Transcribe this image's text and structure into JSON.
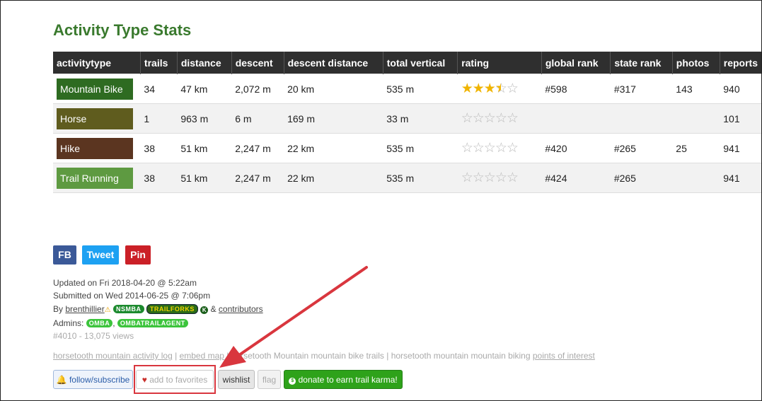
{
  "page_title": "Activity Type Stats",
  "table": {
    "headers": [
      "activitytype",
      "trails",
      "distance",
      "descent",
      "descent distance",
      "total vertical",
      "rating",
      "global rank",
      "state rank",
      "photos",
      "reports"
    ],
    "rows": [
      {
        "activity": "Mountain Bike",
        "color": "#2e6b21",
        "trails": "34",
        "distance": "47 km",
        "descent": "2,072 m",
        "descent_distance": "20 km",
        "total_vertical": "535 m",
        "rating": 3.5,
        "global_rank": "#598",
        "state_rank": "#317",
        "photos": "143",
        "reports": "940"
      },
      {
        "activity": "Horse",
        "color": "#5f5c1e",
        "trails": "1",
        "distance": "963 m",
        "descent": "6 m",
        "descent_distance": "169 m",
        "total_vertical": "33 m",
        "rating": 0,
        "global_rank": "",
        "state_rank": "",
        "photos": "",
        "reports": "101"
      },
      {
        "activity": "Hike",
        "color": "#5b3520",
        "trails": "38",
        "distance": "51 km",
        "descent": "2,247 m",
        "descent_distance": "22 km",
        "total_vertical": "535 m",
        "rating": 0,
        "global_rank": "#420",
        "state_rank": "#265",
        "photos": "25",
        "reports": "941"
      },
      {
        "activity": "Trail Running",
        "color": "#5e9a41",
        "trails": "38",
        "distance": "51 km",
        "descent": "2,247 m",
        "descent_distance": "22 km",
        "total_vertical": "535 m",
        "rating": 0,
        "global_rank": "#424",
        "state_rank": "#265",
        "photos": "",
        "reports": "941"
      }
    ]
  },
  "share": {
    "fb": {
      "label": "FB",
      "color": "#3b5998"
    },
    "tweet": {
      "label": "Tweet",
      "color": "#1da1f2"
    },
    "pin": {
      "label": "Pin",
      "color": "#cb2027"
    }
  },
  "meta": {
    "updated": "Updated on Fri 2018-04-20 @ 5:22am",
    "submitted": "Submitted on Wed 2014-06-25 @ 7:06pm",
    "by_prefix": "By",
    "by_user": "brenthillier",
    "by_tags": [
      "NSMBA",
      "TRAILFORKS"
    ],
    "by_and": "&",
    "contributors": "contributors",
    "admins_prefix": "Admins:",
    "admin_tags": [
      "OMBA",
      "OMBATRAILAGENT"
    ],
    "id_views": "#4010 - 13,075 views"
  },
  "links": {
    "activity_log": "horsetooth mountain activity log",
    "sep1": "|",
    "embed_map": "embed map",
    "sep2": "|",
    "bike_trails": "horsetooth Mountain mountain bike trails",
    "sep3": "|",
    "biking_prefix": "horsetooth mountain mountain biking",
    "poi": "points of interest"
  },
  "actions": {
    "follow": "follow/subscribe",
    "favorites": "add to favorites",
    "wishlist": "wishlist",
    "flag": "flag",
    "donate": "donate to earn trail karma!"
  },
  "colors": {
    "title": "#3a7a2e",
    "star": "#f0b400",
    "annotation": "#d9363e",
    "donate": "#2ea21a"
  }
}
